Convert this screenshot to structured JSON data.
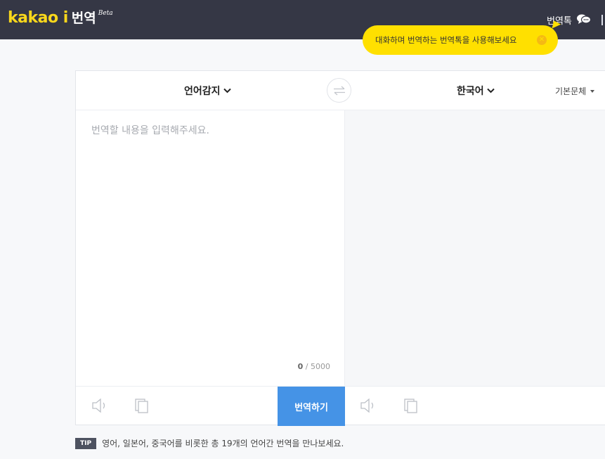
{
  "header": {
    "logo_kakao": "kakao i",
    "logo_name": "번역",
    "logo_beta": "Beta",
    "talk_label": "번역톡",
    "talk_icon": "chat-bubbles-icon"
  },
  "tooltip": {
    "text": "대화하며 번역하는 번역톡을 사용해보세요",
    "close_icon": "close-icon"
  },
  "lang_bar": {
    "source_lang": "언어감지",
    "target_lang": "한국어",
    "swap_icon": "swap-arrows-icon",
    "font_style": "기본문체"
  },
  "source": {
    "placeholder": "번역할 내용을 입력해주세요.",
    "char_count": "0",
    "char_max": "/ 5000"
  },
  "bottom_bar": {
    "translate_label": "번역하기"
  },
  "tip": {
    "badge": "TIP",
    "text": "영어, 일본어, 중국어를 비롯한 총 19개의 언어간 번역을 만나보세요."
  },
  "colors": {
    "header_bg": "#353745",
    "brand_yellow": "#f9d71c",
    "tooltip_bg": "#ffe000",
    "translate_button": "#4593e6"
  }
}
